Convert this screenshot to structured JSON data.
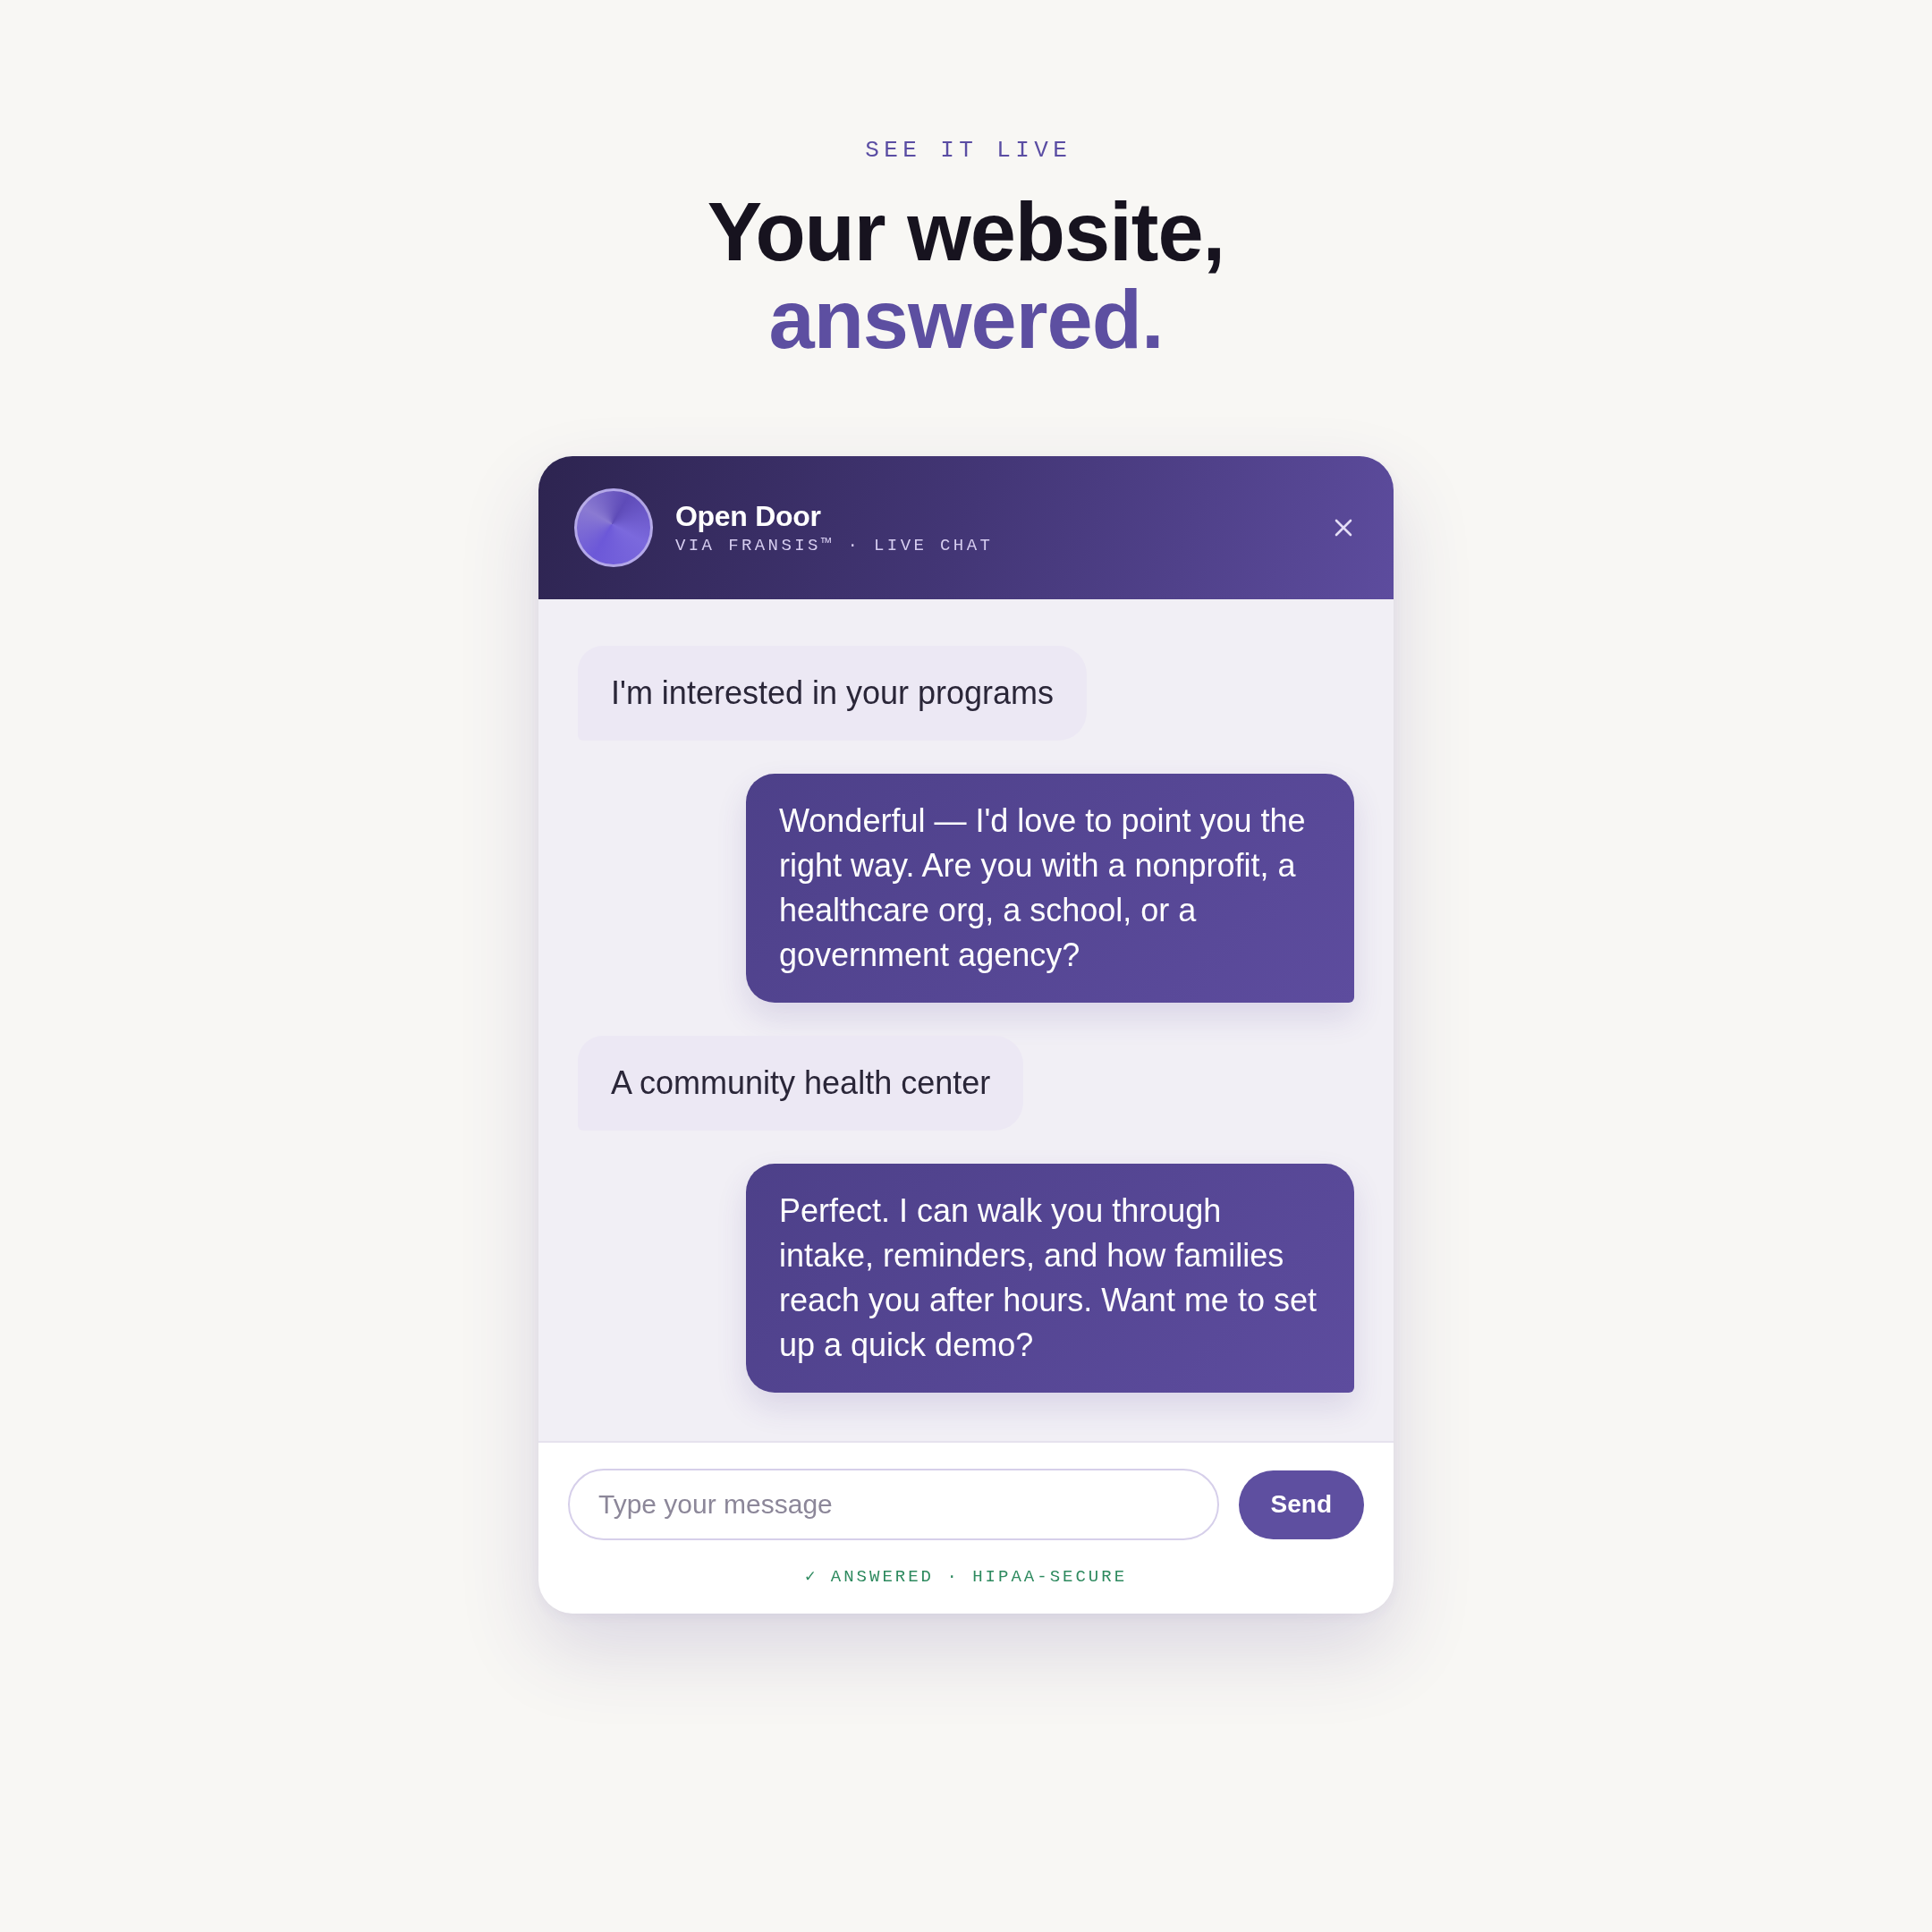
{
  "eyebrow": "SEE IT LIVE",
  "headline": {
    "lines": [
      {
        "text": "Your website,",
        "kind": "plain"
      },
      {
        "text": "answered.",
        "kind": "accent"
      }
    ]
  },
  "chat_widget": {
    "header": {
      "title": "Open Door",
      "subtitle": "VIA FRANSIS™ · LIVE CHAT"
    },
    "messages": [
      {
        "kind": "visitor",
        "text": "I'm interested in your programs"
      },
      {
        "kind": "assistant",
        "text": "Wonderful — I'd love to point you the right way. Are you with a nonprofit, a healthcare org, a school, or a government agency?"
      },
      {
        "kind": "visitor",
        "text": "A community health center"
      },
      {
        "kind": "assistant",
        "text": "Perfect. I can walk you through intake, reminders, and how families reach you after hours. Want me to set up a quick demo?"
      }
    ],
    "composer": {
      "placeholder": "Type your message",
      "send_button": "Send"
    },
    "status": "✓ ANSWERED · HIPAA-SECURE"
  }
}
